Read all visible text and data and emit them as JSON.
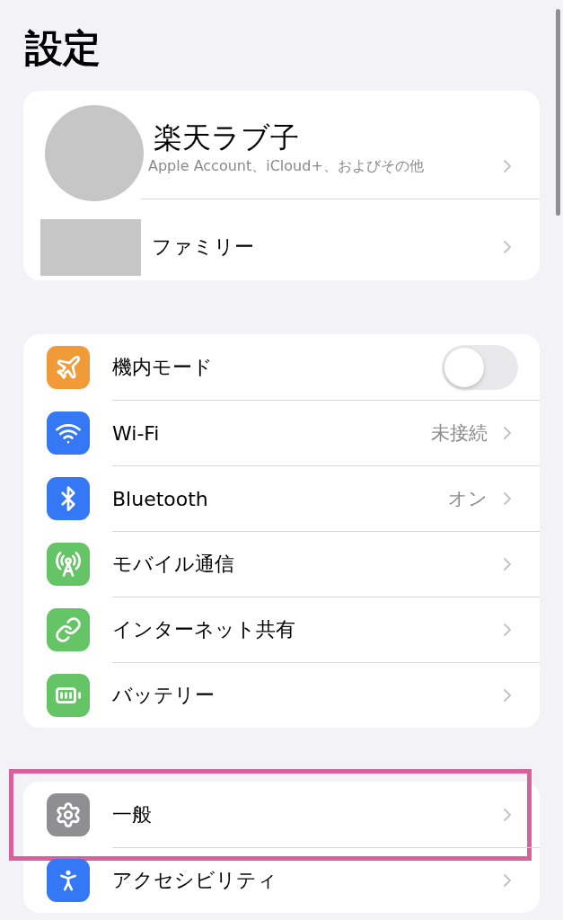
{
  "title": "設定",
  "account": {
    "name": "楽天ラブ子",
    "subtitle": "Apple Account、iCloud+、およびその他",
    "family": "ファミリー"
  },
  "sections": [
    {
      "rows": [
        {
          "label": "機内モード",
          "kind": "toggle",
          "on": false,
          "color": "#f19a38",
          "highlighted": false
        },
        {
          "label": "Wi-Fi",
          "kind": "link",
          "value": "未接続",
          "color": "#3478f6",
          "highlighted": false
        },
        {
          "label": "Bluetooth",
          "kind": "link",
          "value": "オン",
          "color": "#3478f6",
          "highlighted": false
        },
        {
          "label": "モバイル通信",
          "kind": "link",
          "color": "#65c466",
          "highlighted": false
        },
        {
          "label": "インターネット共有",
          "kind": "link",
          "color": "#65c466",
          "highlighted": false
        },
        {
          "label": "バッテリー",
          "kind": "link",
          "color": "#65c466",
          "highlighted": false
        }
      ]
    },
    {
      "rows": [
        {
          "label": "一般",
          "kind": "link",
          "color": "#8e8e93",
          "highlighted": true
        },
        {
          "label": "アクセシビリティ",
          "kind": "link",
          "color": "#3478f6",
          "highlighted": false
        }
      ]
    }
  ]
}
